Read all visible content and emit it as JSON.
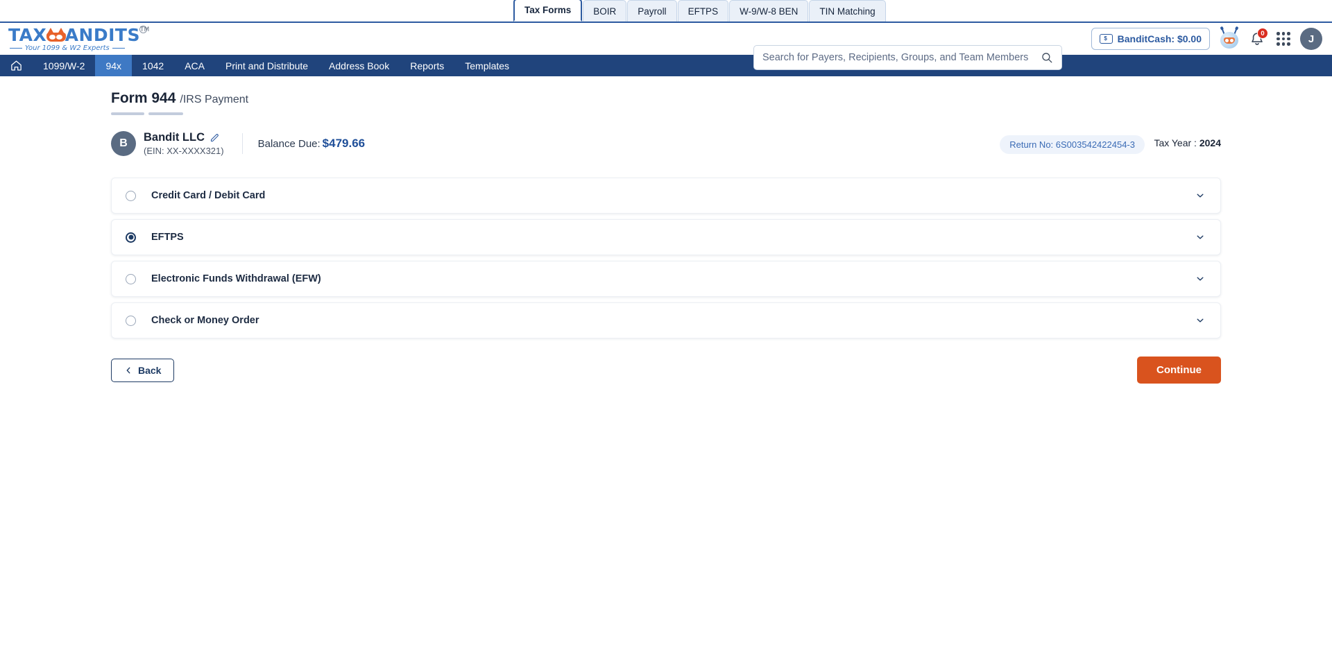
{
  "brand": {
    "logo_text_1": "TAX",
    "logo_text_2": "ANDITS",
    "trademark": "TM",
    "tagline": "Your 1099 & W2 Experts",
    "accent_orange": "#e8622a",
    "accent_blue": "#3a7bc8"
  },
  "top_tabs": [
    {
      "label": "Tax Forms",
      "active": true
    },
    {
      "label": "BOIR",
      "active": false
    },
    {
      "label": "Payroll",
      "active": false
    },
    {
      "label": "EFTPS",
      "active": false
    },
    {
      "label": "W-9/W-8 BEN",
      "active": false
    },
    {
      "label": "TIN Matching",
      "active": false
    }
  ],
  "search": {
    "placeholder": "Search for Payers, Recipients, Groups, and Team Members",
    "value": "",
    "icon": "search-icon"
  },
  "header_right": {
    "bandit_cash_label": "BanditCash: $0.00",
    "wallet_icon": "wallet-icon",
    "bot_icon": "bot-mascot-icon",
    "bell_icon": "bell-icon",
    "notification_count": "0",
    "grid_icon": "apps-grid-icon",
    "avatar_initial": "J"
  },
  "nav": {
    "home_icon": "home-icon",
    "items": [
      {
        "label": "1099/W-2",
        "active": false
      },
      {
        "label": "94x",
        "active": true
      },
      {
        "label": "1042",
        "active": false
      },
      {
        "label": "ACA",
        "active": false
      },
      {
        "label": "Print and Distribute",
        "active": false
      },
      {
        "label": "Address Book",
        "active": false
      },
      {
        "label": "Reports",
        "active": false
      },
      {
        "label": "Templates",
        "active": false
      }
    ],
    "active_bg": "#3e79c4",
    "bar_bg": "#20447c"
  },
  "page": {
    "title_main": "Form 944",
    "title_sub": "/IRS Payment"
  },
  "company": {
    "avatar_initial": "B",
    "name": "Bandit LLC",
    "edit_icon": "pencil-edit-icon",
    "ein": "(EIN: XX-XXXX321)",
    "balance_label": "Balance Due:",
    "balance_amount": "$479.66",
    "return_no": "Return No: 6S003542422454-3",
    "tax_year_label": "Tax Year :",
    "tax_year_value": "2024"
  },
  "payment_options": [
    {
      "label": "Credit Card / Debit Card",
      "selected": false,
      "chevron": "chevron-down-icon"
    },
    {
      "label": "EFTPS",
      "selected": true,
      "chevron": "chevron-down-icon"
    },
    {
      "label": "Electronic Funds Withdrawal (EFW)",
      "selected": false,
      "chevron": "chevron-down-icon"
    },
    {
      "label": "Check or Money Order",
      "selected": false,
      "chevron": "chevron-down-icon"
    }
  ],
  "footer": {
    "back_label": "Back",
    "back_icon": "chevron-left-icon",
    "continue_label": "Continue",
    "continue_color": "#d9531e"
  }
}
